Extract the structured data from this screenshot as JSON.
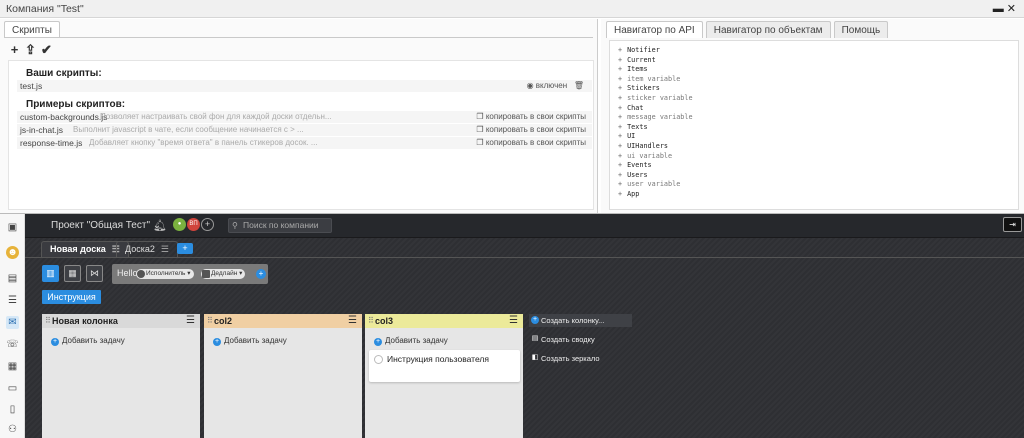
{
  "window": {
    "title": "Компания \"Test\""
  },
  "left_pane": {
    "tab": "Скрипты",
    "your_scripts_heading": "Ваши скрипты:",
    "user_scripts": [
      {
        "name": "test.js",
        "status": "включен"
      }
    ],
    "examples_heading": "Примеры скриптов:",
    "examples": [
      {
        "name": "custom-backgrounds.js",
        "desc": "Позволяет настраивать свой фон для каждой доски отдельн...",
        "action": "копировать в свои скрипты"
      },
      {
        "name": "js-in-chat.js",
        "desc": "Выполнит javascript в чате, если сообщение начинается с > ...",
        "action": "копировать в свои скрипты"
      },
      {
        "name": "response-time.js",
        "desc": "Добавляет кнопку \"время ответа\" в панель стикеров досок. ...",
        "action": "копировать в свои скрипты"
      }
    ]
  },
  "right_pane": {
    "tabs": [
      "Навигатор по API",
      "Навигатор по объектам",
      "Помощь"
    ],
    "api_items": [
      "Notifier",
      "Current",
      "Items",
      "item variable",
      "Stickers",
      "sticker variable",
      "Chat",
      "message variable",
      "Texts",
      "UI",
      "UIHandlers",
      "ui variable",
      "Events",
      "Users",
      "user variable",
      "App"
    ]
  },
  "board": {
    "project": "Проект \"Общая Тест\"",
    "avatar_initials": "ВП",
    "search_placeholder": "Поиск по компании",
    "tabs": [
      "Новая доска",
      "Доска2"
    ],
    "filter": {
      "text": "Hello",
      "assignee": "Исполнитель",
      "deadline": "Дедлайн"
    },
    "instruction_button": "Инструкция",
    "add_task": "Добавить задачу",
    "columns": [
      {
        "title": "Новая колонка",
        "color": "#d9d9d9"
      },
      {
        "title": "col2",
        "color": "#f0cfa3"
      },
      {
        "title": "col3",
        "color": "#ecea9a"
      }
    ],
    "card": "Инструкция пользователя",
    "create_menu": [
      "Создать колонку...",
      "Создать сводку",
      "Создать зеркало"
    ]
  }
}
